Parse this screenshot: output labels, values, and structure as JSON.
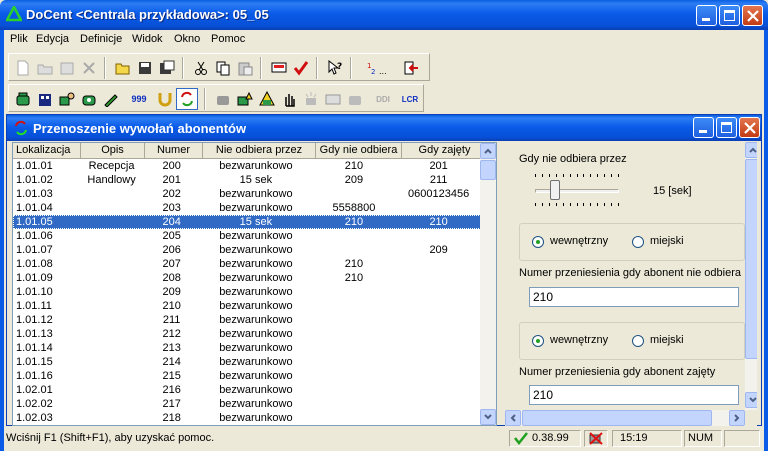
{
  "app": {
    "title": "DoCent <Centrala przykładowa>: 05_05"
  },
  "menu": [
    "Plik",
    "Edycja",
    "Definicje",
    "Widok",
    "Okno",
    "Pomoc"
  ],
  "toolbar_icons": [
    "new-document-icon",
    "open-icon",
    "properties-icon",
    "delete-icon",
    "open-folder-icon",
    "save-icon",
    "save-as-icon",
    "cut-icon",
    "copy-icon",
    "paste-icon",
    "monitor-icon",
    "check-icon",
    "help-pointer-icon",
    "sort-icon",
    "exit-icon"
  ],
  "toolbar2_icons": [
    "phone-icon",
    "building-icon",
    "phone-user-icon",
    "green-phone-icon",
    "pen-icon",
    "numbers-icon",
    "magnet-icon",
    "transfer-icon",
    "disabled-phone-icon",
    "phone-alert-icon",
    "phone-warning-icon",
    "hand-icon",
    "alarm-icon",
    "card-icon",
    "phone-gray-icon",
    "ddi-icon",
    "lcr-icon"
  ],
  "toolbar2_labels": {
    "n999": "999",
    "ddi": "DDI",
    "lcr": "LCR"
  },
  "child": {
    "title": "Przenoszenie wywołań abonentów"
  },
  "table": {
    "columns": [
      "Lokalizacja",
      "Opis",
      "Numer",
      "Nie odbiera przez",
      "Gdy nie odbiera",
      "Gdy zajęty"
    ],
    "rows": [
      [
        "1.01.01",
        "Recepcja",
        "200",
        "bezwarunkowo",
        "210",
        "201"
      ],
      [
        "1.01.02",
        "Handlowy",
        "201",
        "15 sek",
        "209",
        "211"
      ],
      [
        "1.01.03",
        "",
        "202",
        "bezwarunkowo",
        "",
        "0600123456"
      ],
      [
        "1.01.04",
        "",
        "203",
        "bezwarunkowo",
        "5558800",
        ""
      ],
      [
        "1.01.05",
        "",
        "204",
        "15 sek",
        "210",
        "210"
      ],
      [
        "1.01.06",
        "",
        "205",
        "bezwarunkowo",
        "",
        ""
      ],
      [
        "1.01.07",
        "",
        "206",
        "bezwarunkowo",
        "",
        "209"
      ],
      [
        "1.01.08",
        "",
        "207",
        "bezwarunkowo",
        "210",
        ""
      ],
      [
        "1.01.09",
        "",
        "208",
        "bezwarunkowo",
        "210",
        ""
      ],
      [
        "1.01.10",
        "",
        "209",
        "bezwarunkowo",
        "",
        ""
      ],
      [
        "1.01.11",
        "",
        "210",
        "bezwarunkowo",
        "",
        ""
      ],
      [
        "1.01.12",
        "",
        "211",
        "bezwarunkowo",
        "",
        ""
      ],
      [
        "1.01.13",
        "",
        "212",
        "bezwarunkowo",
        "",
        ""
      ],
      [
        "1.01.14",
        "",
        "213",
        "bezwarunkowo",
        "",
        ""
      ],
      [
        "1.01.15",
        "",
        "214",
        "bezwarunkowo",
        "",
        ""
      ],
      [
        "1.01.16",
        "",
        "215",
        "bezwarunkowo",
        "",
        ""
      ],
      [
        "1.02.01",
        "",
        "216",
        "bezwarunkowo",
        "",
        ""
      ],
      [
        "1.02.02",
        "",
        "217",
        "bezwarunkowo",
        "",
        ""
      ],
      [
        "1.02.03",
        "",
        "218",
        "bezwarunkowo",
        "",
        ""
      ]
    ],
    "selected_row": 4
  },
  "panel": {
    "no_answer_label": "Gdy nie odbiera przez",
    "slider_value": "15 [sek]",
    "slider_fraction": 0.2,
    "radio_internal": "wewnętrzny",
    "radio_external": "miejski",
    "no_answer_number_label": "Numer przeniesienia gdy abonent nie odbiera",
    "no_answer_number_value": "210",
    "radio_internal_2": "wewnętrzny",
    "radio_external_2": "miejski",
    "busy_number_label": "Numer przeniesienia gdy abonent zajęty",
    "busy_number_value": "210"
  },
  "status": {
    "help_text": "Wciśnij F1 (Shift+F1), aby uzyskać pomoc.",
    "version": "0.38.99",
    "time": "15:19",
    "num": "NUM"
  }
}
